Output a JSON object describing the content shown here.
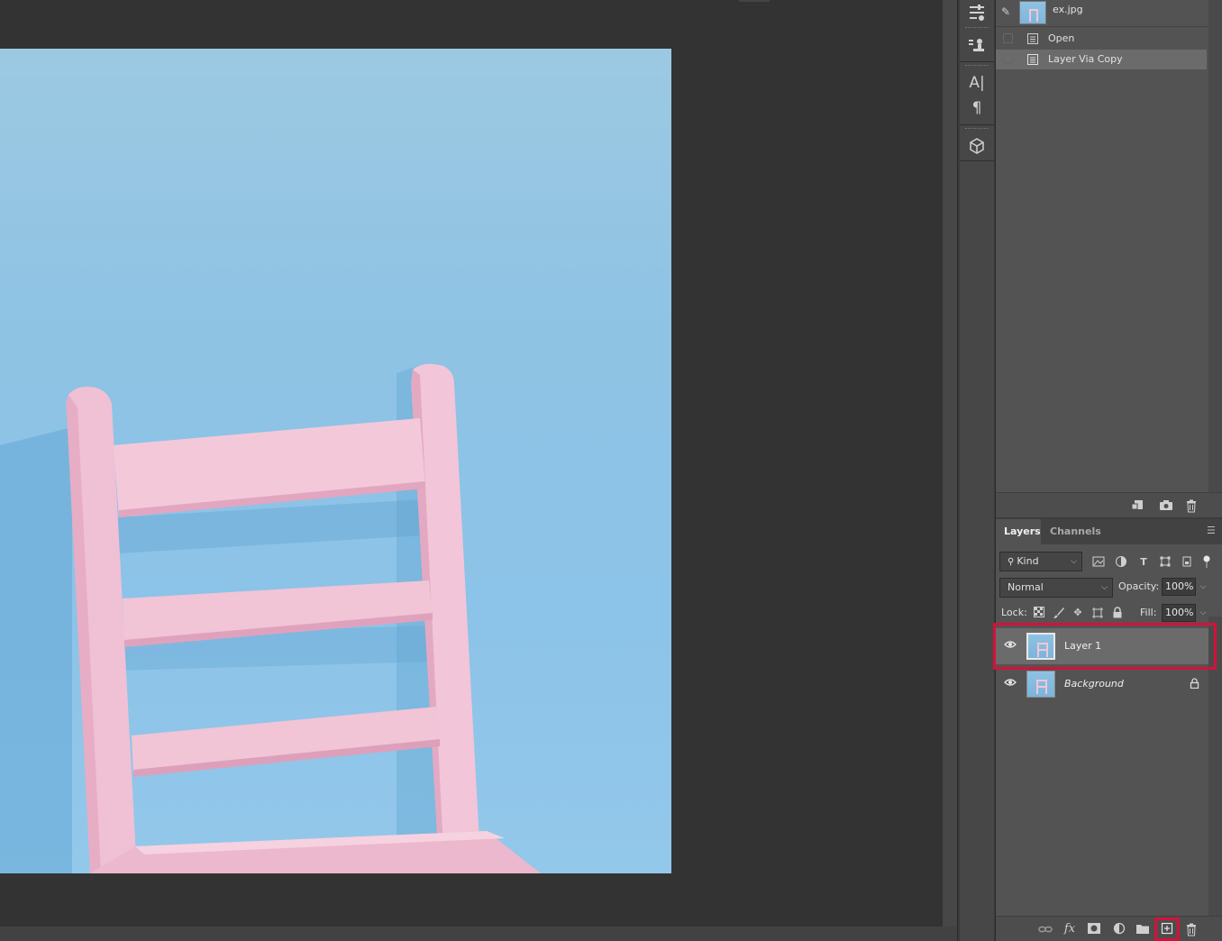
{
  "document": {
    "image_description": "pink wooden chair against light blue wall"
  },
  "tools": {
    "icons": [
      "adjustments-icon",
      "clone-source-icon",
      "character-icon",
      "paragraph-icon",
      "3d-icon"
    ]
  },
  "history": {
    "snapshot_name": "ex.jpg",
    "states": [
      {
        "label": "Open",
        "active": false
      },
      {
        "label": "Layer Via Copy",
        "active": true
      }
    ],
    "footer_icons": [
      "new-document-from-state-icon",
      "camera-icon",
      "trash-icon"
    ]
  },
  "layers_panel": {
    "tabs": [
      {
        "label": "Layers",
        "active": true
      },
      {
        "label": "Channels",
        "active": false
      }
    ],
    "filter": {
      "kind_label": "Kind",
      "icons": [
        "pixel-filter-icon",
        "adjustment-filter-icon",
        "type-filter-icon",
        "shape-filter-icon",
        "smart-object-filter-icon",
        "filter-toggle-icon"
      ]
    },
    "blend_mode": "Normal",
    "opacity_label": "Opacity:",
    "opacity_value": "100%",
    "lock_label": "Lock:",
    "fill_label": "Fill:",
    "fill_value": "100%",
    "layers": [
      {
        "name": "Layer 1",
        "visible": true,
        "selected": true,
        "locked": false
      },
      {
        "name": "Background",
        "visible": true,
        "selected": false,
        "locked": true
      }
    ],
    "footer_icons": [
      "link-layers-icon",
      "fx-icon",
      "add-mask-icon",
      "adjustment-layer-icon",
      "new-group-icon",
      "new-layer-icon",
      "delete-layer-icon"
    ]
  },
  "colors": {
    "highlight": "#d5113a",
    "wall": "#8ec3e4",
    "chair": "#f1c4d6",
    "panel": "#535353"
  }
}
